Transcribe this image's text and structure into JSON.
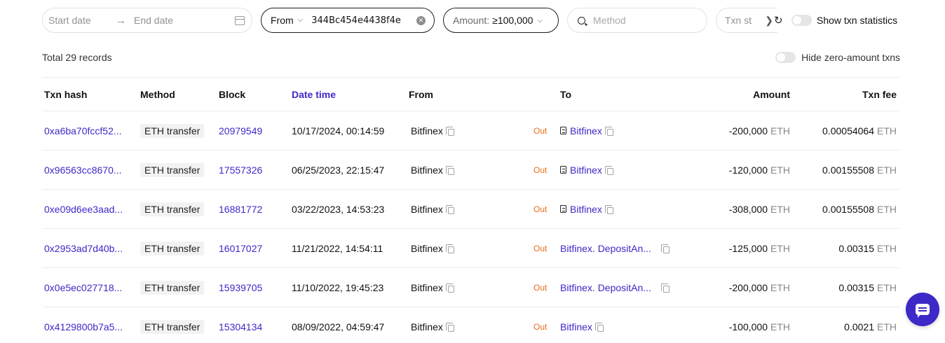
{
  "filters": {
    "start_date_placeholder": "Start date",
    "end_date_placeholder": "End date",
    "from_label": "From",
    "from_address": "344Bc454e4438f4e",
    "amount_label": "Amount:",
    "amount_value": "≥100,000",
    "method_placeholder": "Method",
    "txn_status_label": "Txn st",
    "show_stats_label": "Show txn statistics",
    "show_stats_enabled": false
  },
  "summary": {
    "total_records": "Total 29 records",
    "hide_zero_label": "Hide zero-amount txns",
    "hide_zero_enabled": false
  },
  "table": {
    "headers": {
      "hash": "Txn hash",
      "method": "Method",
      "block": "Block",
      "datetime": "Date time",
      "from": "From",
      "to": "To",
      "amount": "Amount",
      "fee": "Txn fee"
    },
    "rows": [
      {
        "hash": "0xa6ba70fccf52...",
        "method": "ETH transfer",
        "block": "20979549",
        "datetime": "10/17/2024, 00:14:59",
        "from": "Bitfinex",
        "direction": "Out",
        "to": "Bitfinex",
        "to_is_contract": true,
        "amount": "-200,000",
        "amount_unit": "ETH",
        "fee": "0.00054064",
        "fee_unit": "ETH"
      },
      {
        "hash": "0x96563cc8670...",
        "method": "ETH transfer",
        "block": "17557326",
        "datetime": "06/25/2023, 22:15:47",
        "from": "Bitfinex",
        "direction": "Out",
        "to": "Bitfinex",
        "to_is_contract": true,
        "amount": "-120,000",
        "amount_unit": "ETH",
        "fee": "0.00155508",
        "fee_unit": "ETH"
      },
      {
        "hash": "0xe09d6ee3aad...",
        "method": "ETH transfer",
        "block": "16881772",
        "datetime": "03/22/2023, 14:53:23",
        "from": "Bitfinex",
        "direction": "Out",
        "to": "Bitfinex",
        "to_is_contract": true,
        "amount": "-308,000",
        "amount_unit": "ETH",
        "fee": "0.00155508",
        "fee_unit": "ETH"
      },
      {
        "hash": "0x2953ad7d40b...",
        "method": "ETH transfer",
        "block": "16017027",
        "datetime": "11/21/2022, 14:54:11",
        "from": "Bitfinex",
        "direction": "Out",
        "to": "Bitfinex. DepositAn...",
        "to_is_contract": false,
        "amount": "-125,000",
        "amount_unit": "ETH",
        "fee": "0.00315",
        "fee_unit": "ETH"
      },
      {
        "hash": "0x0e5ec027718...",
        "method": "ETH transfer",
        "block": "15939705",
        "datetime": "11/10/2022, 19:45:23",
        "from": "Bitfinex",
        "direction": "Out",
        "to": "Bitfinex. DepositAn...",
        "to_is_contract": false,
        "amount": "-200,000",
        "amount_unit": "ETH",
        "fee": "0.00315",
        "fee_unit": "ETH"
      },
      {
        "hash": "0x4129800b7a5...",
        "method": "ETH transfer",
        "block": "15304134",
        "datetime": "08/09/2022, 04:59:47",
        "from": "Bitfinex",
        "direction": "Out",
        "to": "Bitfinex",
        "to_is_contract": false,
        "amount": "-100,000",
        "amount_unit": "ETH",
        "fee": "0.0021",
        "fee_unit": "ETH"
      }
    ]
  },
  "colors": {
    "accent": "#3d29c7",
    "out": "#ea6d1a",
    "muted": "#888888"
  },
  "icons": {
    "calendar": "calendar-icon",
    "copy": "copy-icon",
    "contract": "contract-icon",
    "refresh": "refresh-icon",
    "chat": "chat-icon"
  }
}
